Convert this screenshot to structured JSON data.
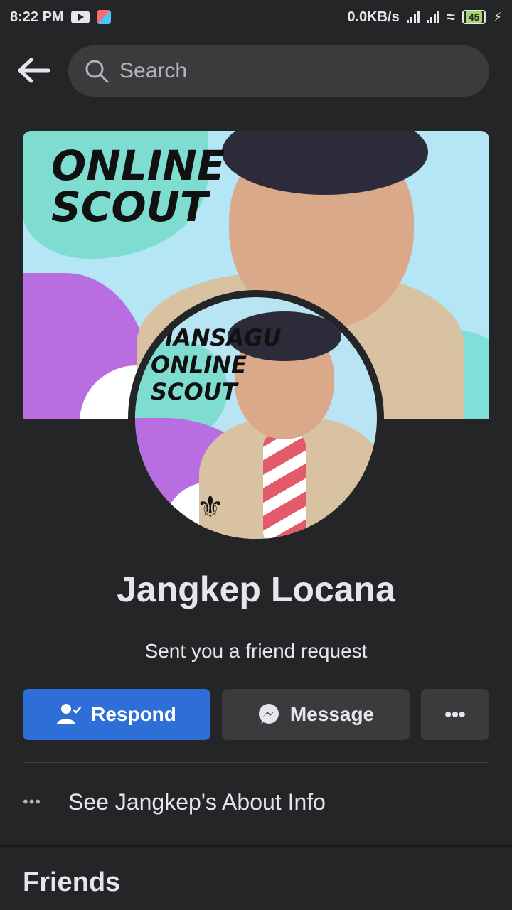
{
  "status_bar": {
    "time": "8:22 PM",
    "network_speed": "0.0KB/s",
    "battery_level": "45"
  },
  "header": {
    "search_placeholder": "Search"
  },
  "cover": {
    "text_lines": [
      "ONLINE",
      "SCOUT"
    ]
  },
  "avatar": {
    "text_lines": [
      "MANSAGU",
      "ONLINE",
      "SCOUT"
    ]
  },
  "profile": {
    "name": "Jangkep Locana",
    "subtitle": "Sent you a friend request"
  },
  "actions": {
    "respond_label": "Respond",
    "message_label": "Message",
    "more_label": "•••"
  },
  "about": {
    "dots": "•••",
    "label": "See Jangkep's About Info"
  },
  "friends": {
    "title": "Friends"
  },
  "colors": {
    "background": "#242526",
    "primary_button": "#2d6fd6",
    "secondary_button": "#3a3b3c",
    "text": "#e4e6eb"
  }
}
